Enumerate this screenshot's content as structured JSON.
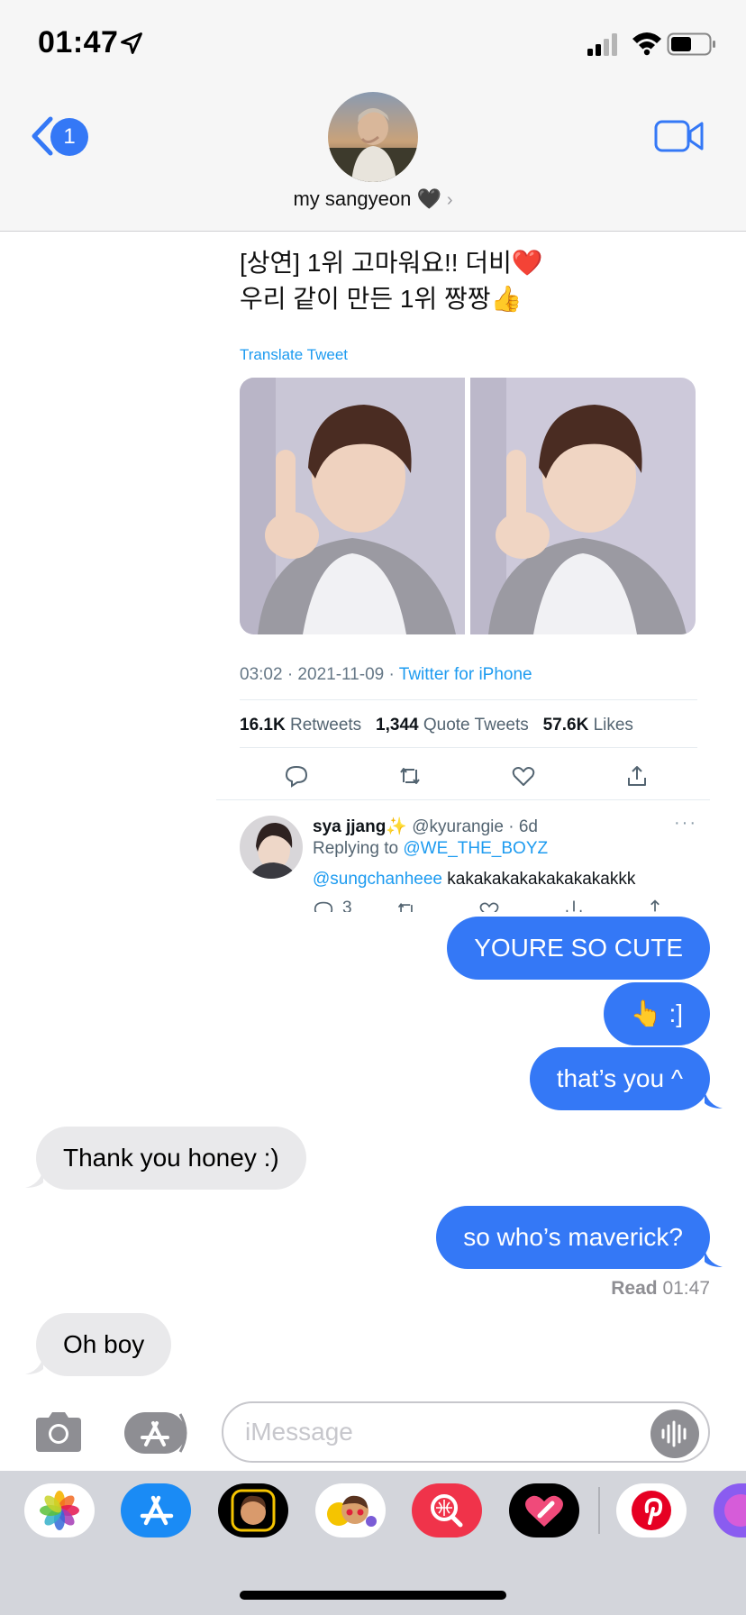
{
  "status": {
    "time": "01:47"
  },
  "header": {
    "back_count": "1",
    "contact_name": "my sangyeon 🖤",
    "contact_chevron": "›"
  },
  "tweet": {
    "text_line1": "[상연] 1위 고마워요!! 더비❤️",
    "text_line2": "우리 같이 만든 1위 짱짱👍",
    "translate": "Translate Tweet",
    "meta_time": "03:02 · 2021-11-09 · ",
    "meta_source": "Twitter for iPhone",
    "retweets_count": "16.1K",
    "retweets_label": " Retweets",
    "quotes_count": "1,344",
    "quotes_label": " Quote Tweets",
    "likes_count": "57.6K",
    "likes_label": " Likes"
  },
  "reply": {
    "name": "sya jjang✨",
    "handle": " @kyurangie · 6d",
    "more": "···",
    "replying_prefix": "Replying to ",
    "replying_to": "@WE_THE_BOYZ",
    "mention": "@sungchanheee",
    "body": " kakakakakakakakakakkk",
    "reply_count": "3"
  },
  "messages": [
    {
      "side": "out",
      "text": "YOURE SO CUTE"
    },
    {
      "side": "out",
      "text": "👆 :]"
    },
    {
      "side": "out",
      "text": "that’s you ^"
    },
    {
      "side": "in",
      "text": "Thank you honey :)"
    },
    {
      "side": "out",
      "text": "so who’s maverick?"
    },
    {
      "side": "in",
      "text": "Oh boy"
    }
  ],
  "read_receipt": {
    "label": "Read",
    "time": " 01:47"
  },
  "input": {
    "placeholder": "iMessage"
  },
  "colors": {
    "imessage_blue": "#3478f6",
    "incoming_gray": "#e9e9eb",
    "twitter_blue": "#1d9bf0"
  },
  "apps": [
    "photos-icon",
    "appstore-icon",
    "memoji-icon",
    "animoji-icon",
    "images-search-icon",
    "digital-touch-icon",
    "pinterest-icon",
    "app-icon"
  ]
}
